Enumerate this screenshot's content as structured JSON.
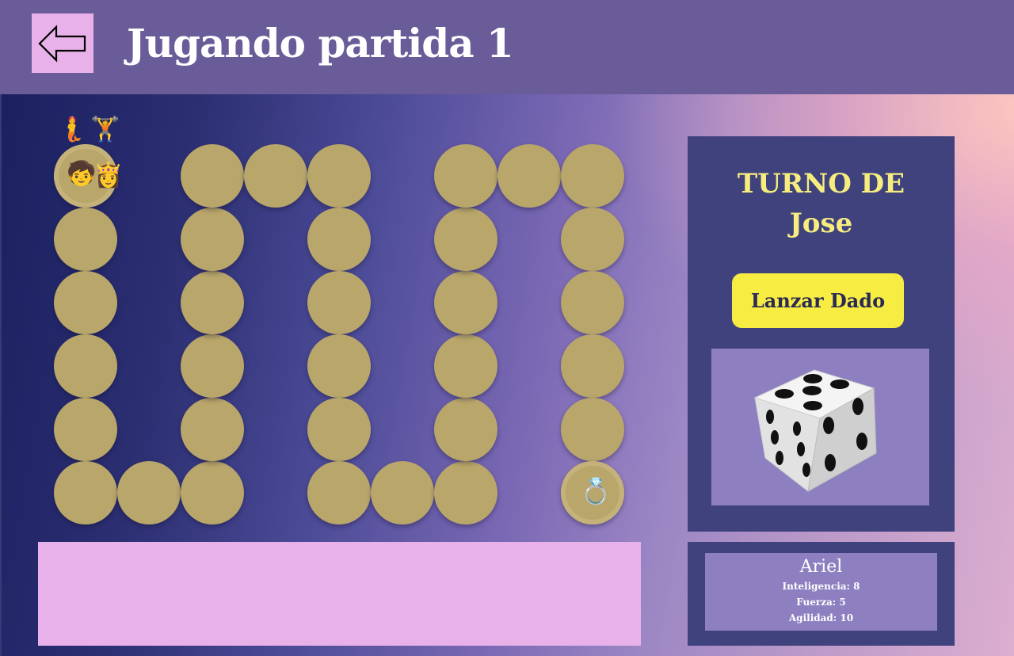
{
  "header": {
    "title": "Jugando partida 1",
    "back_icon": "arrow-left-icon",
    "colors": {
      "bar": "#6a5c98",
      "back_button": "#e8b1e9"
    }
  },
  "board": {
    "cell_color": "#b8a66a",
    "cells_per_path": 36,
    "tokens": [
      {
        "icon": "ariel-token-icon",
        "glyph": "🧜"
      },
      {
        "icon": "hercules-token-icon",
        "glyph": "🏋"
      },
      {
        "icon": "mowgli-token-icon",
        "glyph": "🧒"
      },
      {
        "icon": "rapunzel-token-icon",
        "glyph": "👸"
      }
    ],
    "goal": {
      "icon": "ring-icon",
      "glyph": "💍"
    }
  },
  "turn": {
    "title": "TURNO DE",
    "player": "Jose",
    "roll_button": "Lanzar Dado",
    "dice_icon": "dice-icon",
    "colors": {
      "panel": "#40427e",
      "text": "#f7ed7e",
      "button": "#f7ec42",
      "dice_box": "#8e80c0"
    }
  },
  "player_info": {
    "name": "Ariel",
    "stats": [
      "Inteligencia: 8",
      "Fuerza: 5",
      "Agilidad: 10"
    ]
  },
  "log": {
    "color": "#e8b1e9"
  }
}
